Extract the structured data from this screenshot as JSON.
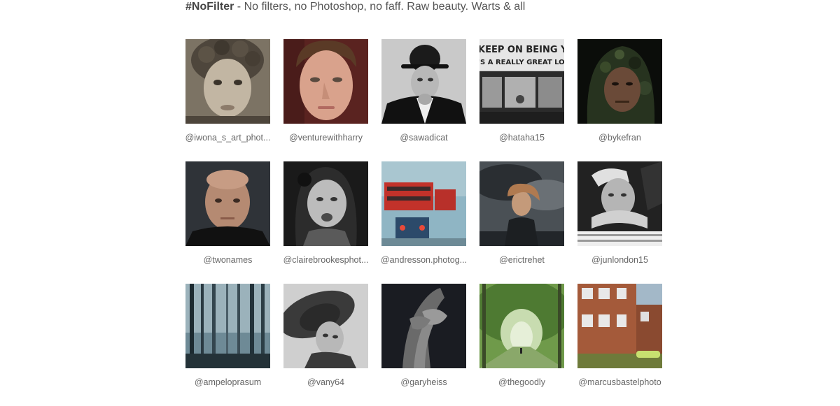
{
  "header": {
    "tag": "#NoFilter",
    "description": " - No filters, no Photoshop, no faff. Raw beauty. Warts & all"
  },
  "photos": [
    {
      "handle": "@iwona_s_art_phot...",
      "subject": "curly-haired boy portrait, sepia"
    },
    {
      "handle": "@venturewithharry",
      "subject": "young man close-up portrait"
    },
    {
      "handle": "@sawadicat",
      "subject": "elderly man in bowler hat, black and white"
    },
    {
      "handle": "@hataha15",
      "subject": "bus window with billboard text"
    },
    {
      "handle": "@bykefran",
      "subject": "man in camouflage hood, dark"
    },
    {
      "handle": "@twonames",
      "subject": "bald man portrait"
    },
    {
      "handle": "@clairebrookesphot...",
      "subject": "crying girl, black and white"
    },
    {
      "handle": "@andresson.photog...",
      "subject": "red buses through rainy window"
    },
    {
      "handle": "@erictrehet",
      "subject": "child under stormy sky"
    },
    {
      "handle": "@junlondon15",
      "subject": "man being held, black and white"
    },
    {
      "handle": "@ampeloprasum",
      "subject": "misty forest"
    },
    {
      "handle": "@vany64",
      "subject": "girl in wide-brim hat"
    },
    {
      "handle": "@garyheiss",
      "subject": "weathered clasped hands"
    },
    {
      "handle": "@thegoodly",
      "subject": "green tree tunnel path"
    },
    {
      "handle": "@marcusbastelphoto",
      "subject": "brick apartment building"
    }
  ]
}
